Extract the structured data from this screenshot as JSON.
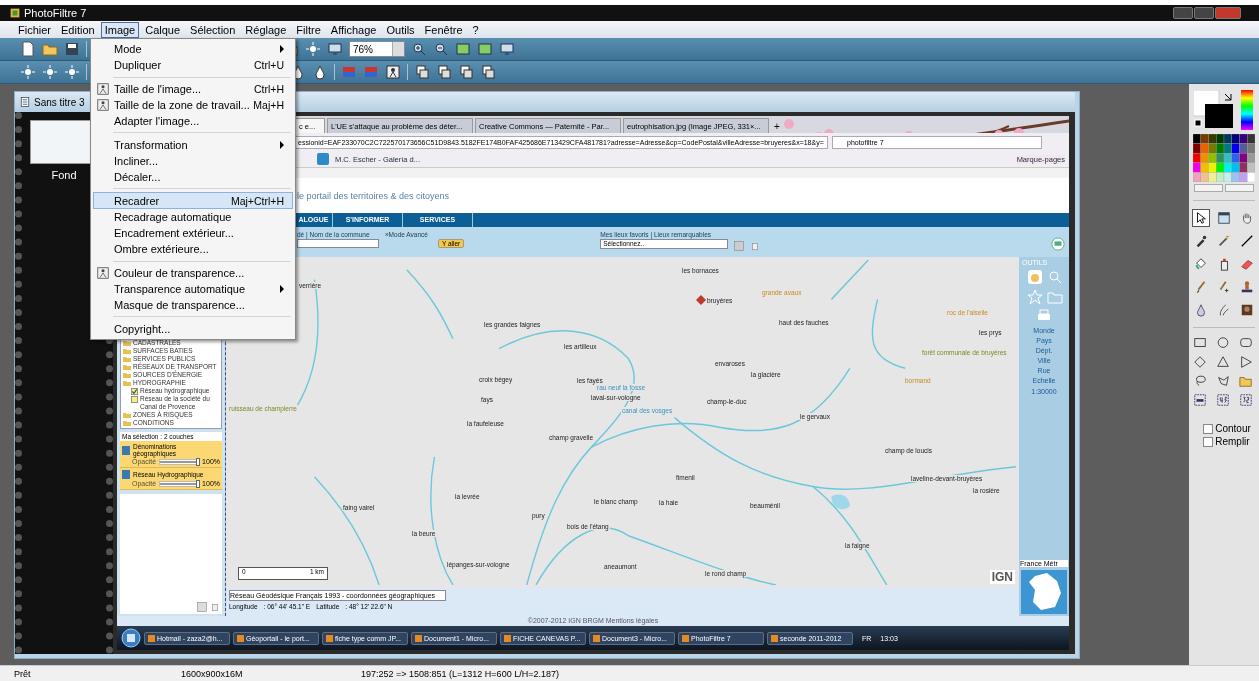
{
  "window": {
    "title": "PhotoFiltre 7"
  },
  "menu_bar": [
    {
      "label": "Fichier",
      "selected": false
    },
    {
      "label": "Edition",
      "selected": false
    },
    {
      "label": "Image",
      "selected": true
    },
    {
      "label": "Calque",
      "selected": false
    },
    {
      "label": "Sélection",
      "selected": false
    },
    {
      "label": "Réglage",
      "selected": false
    },
    {
      "label": "Filtre",
      "selected": false
    },
    {
      "label": "Affichage",
      "selected": false
    },
    {
      "label": "Outils",
      "selected": false
    },
    {
      "label": "Fenêtre",
      "selected": false
    },
    {
      "label": "?",
      "selected": false
    }
  ],
  "toolbar": {
    "zoom_value": "76%"
  },
  "image_menu": [
    {
      "kind": "item",
      "label": "Mode",
      "submenu": true,
      "selected": false
    },
    {
      "kind": "item",
      "label": "Dupliquer",
      "shortcut": "Ctrl+U",
      "selected": false
    },
    {
      "kind": "separator"
    },
    {
      "kind": "item",
      "label": "Taille de l'image...",
      "shortcut": "Ctrl+H",
      "icon": true,
      "selected": false
    },
    {
      "kind": "item",
      "label": "Taille de la zone de travail...",
      "shortcut": "Maj+H",
      "icon": true,
      "selected": false
    },
    {
      "kind": "item",
      "label": "Adapter l'image...",
      "selected": false
    },
    {
      "kind": "separator"
    },
    {
      "kind": "item",
      "label": "Transformation",
      "submenu": true,
      "selected": false
    },
    {
      "kind": "item",
      "label": "Incliner...",
      "selected": false
    },
    {
      "kind": "item",
      "label": "Décaler...",
      "selected": false
    },
    {
      "kind": "separator"
    },
    {
      "kind": "item",
      "label": "Recadrer",
      "shortcut": "Maj+Ctrl+H",
      "selected": true
    },
    {
      "kind": "item",
      "label": "Recadrage automatique",
      "selected": false
    },
    {
      "kind": "item",
      "label": "Encadrement extérieur...",
      "selected": false
    },
    {
      "kind": "item",
      "label": "Ombre extérieure...",
      "selected": false
    },
    {
      "kind": "separator"
    },
    {
      "kind": "item",
      "label": "Couleur de transparence...",
      "icon": true,
      "selected": false
    },
    {
      "kind": "item",
      "label": "Transparence automatique",
      "submenu": true,
      "selected": false
    },
    {
      "kind": "item",
      "label": "Masque de transparence...",
      "selected": false
    },
    {
      "kind": "separator"
    },
    {
      "kind": "item",
      "label": "Copyright...",
      "selected": false
    }
  ],
  "document": {
    "title": "Sans titre 3",
    "layers": [
      {
        "name": "Fond"
      }
    ]
  },
  "browser": {
    "tabs": [
      {
        "label": "c e...",
        "selected": true
      },
      {
        "label": "L'UE s'attaque au problème des déter...",
        "selected": false
      },
      {
        "label": "Creative Commons — Paternité - Par...",
        "selected": false
      },
      {
        "label": "eutrophisation.jpg (Image JPEG, 331×...",
        "selected": false
      }
    ],
    "new_tab": "+",
    "url": "essionid=EAF233070C2C722570173656C51D9843.5182FE174B0FAF425686E713429CFA481781?adresse=Adresse&cp=CodePostal&villeAdresse=bruyeres&x=18&y=",
    "search_value": "photofiltre 7",
    "bookmark": "M.C. Escher - Galería d...",
    "bookmarks_menu": "Marque-pages",
    "tagline": "le portail des territoires & des citoyens",
    "nav": [
      "ALOGUE",
      "S'INFORMER",
      "SERVICES"
    ],
    "search_label": "dé | Nom de la commune",
    "advanced_link": "»Mode Avancé",
    "go_button": "Y aller",
    "favorites_label": "Mes lieux favoris | Lieux remarquables",
    "favorites_select": "Sélectionnez..",
    "layer_tree": [
      {
        "label": "CADASTRALES"
      },
      {
        "label": "SURFACES BATIES"
      },
      {
        "label": "SERVICES PUBLICS"
      },
      {
        "label": "RÉSEAUX DE TRANSPORT"
      },
      {
        "label": "SOURCES D'ÉNERGIE"
      },
      {
        "label": "HYDROGRAPHIE",
        "children": [
          {
            "label": "Réseau hydrographique",
            "checked": true
          },
          {
            "label": "Réseau de la société du Canal de Provence",
            "checked": false
          }
        ]
      },
      {
        "label": "ZONES À RISQUES"
      },
      {
        "label": "CONDITIONS"
      }
    ],
    "selection_title": "Ma sélection : 2 couches",
    "selection_layers": [
      {
        "name": "Dénominations géographiques",
        "opacity_label": "Opacité",
        "level": 1,
        "reading": "100%"
      },
      {
        "name": "Réseau Hydrographique",
        "opacity_label": "Opacité",
        "level": 1,
        "reading": "100%"
      }
    ],
    "map_labels": [
      {
        "text": "les bornaces",
        "kind": "place"
      },
      {
        "text": "bruyères",
        "kind": "place"
      },
      {
        "text": "grande avaux",
        "kind": "area"
      },
      {
        "text": "haut des fauches",
        "kind": "place"
      },
      {
        "text": "les grandes faignes",
        "kind": "place"
      },
      {
        "text": "les artilleux",
        "kind": "place"
      },
      {
        "text": "croix bégey",
        "kind": "place"
      },
      {
        "text": "les fayés",
        "kind": "place"
      },
      {
        "text": "fays",
        "kind": "place"
      },
      {
        "text": "laval-sur-vologne",
        "kind": "place"
      },
      {
        "text": "envaroses",
        "kind": "place"
      },
      {
        "text": "la glacière",
        "kind": "place"
      },
      {
        "text": "champ-le-duc",
        "kind": "place"
      },
      {
        "text": "la faufeleuse",
        "kind": "place"
      },
      {
        "text": "champ gravelle",
        "kind": "place"
      },
      {
        "text": "le gervaux",
        "kind": "place"
      },
      {
        "text": "champ de loucis",
        "kind": "place"
      },
      {
        "text": "laveline-devant-bruyères",
        "kind": "place"
      },
      {
        "text": "la rosière",
        "kind": "place"
      },
      {
        "text": "fimenil",
        "kind": "place"
      },
      {
        "text": "le blanc champ",
        "kind": "place"
      },
      {
        "text": "la haie",
        "kind": "place"
      },
      {
        "text": "beauménil",
        "kind": "place"
      },
      {
        "text": "faing vairel",
        "kind": "place"
      },
      {
        "text": "la levrée",
        "kind": "place"
      },
      {
        "text": "pury",
        "kind": "place"
      },
      {
        "text": "bois de l'étang",
        "kind": "place"
      },
      {
        "text": "la beure",
        "kind": "place"
      },
      {
        "text": "lépanges-sur-vologne",
        "kind": "place"
      },
      {
        "text": "aneaumont",
        "kind": "place"
      },
      {
        "text": "le rond champ",
        "kind": "place"
      },
      {
        "text": "la faigne",
        "kind": "place"
      },
      {
        "text": "verrière",
        "kind": "place"
      },
      {
        "text": "roc de l'aiselle",
        "kind": "area"
      },
      {
        "text": "forêt communale de bruyères",
        "kind": "forest"
      },
      {
        "text": "bormand",
        "kind": "area"
      },
      {
        "text": "ruisseau de champlerre",
        "kind": "forest"
      },
      {
        "text": "rau neuf la fosse",
        "kind": "water"
      },
      {
        "text": "canal des vosges",
        "kind": "water"
      },
      {
        "text": "les prys",
        "kind": "place"
      }
    ],
    "scale": [
      "0",
      "1 km"
    ],
    "map_tools": {
      "title": "OUTILS",
      "levels": [
        "Monde",
        "Pays",
        "Dépt.",
        "Ville",
        "Rue"
      ],
      "scale_label": "Echelle",
      "scale_value": "1:30000",
      "region": "France Métr",
      "logo": "IGN"
    },
    "coord_system": "Réseau Géodésique Français 1993 - coordonnées géographiques",
    "longitude_label": "Longitude",
    "longitude": ": 06° 44' 45.1\" E",
    "latitude_label": "Latitude",
    "latitude": ": 48° 12' 22.6\" N",
    "copyright": "©2007-2012 IGN BRGM Mentions légales",
    "taskbar": [
      "Hotmail - zaza2@h...",
      "Géoportail - le port...",
      "fiche type comm JP...",
      "Document1 - Micro...",
      "FICHE CANEVAS P...",
      "Document3 - Micro...",
      "PhotoFiltre 7",
      "seconde 2011-2012"
    ],
    "tray": {
      "language": "FR",
      "time": "13:03"
    }
  },
  "tools": [
    {
      "selected": true
    },
    {
      "selected": false
    },
    {
      "selected": false
    },
    {
      "selected": false
    },
    {
      "selected": false
    },
    {
      "selected": false
    },
    {
      "selected": false
    },
    {
      "selected": false
    },
    {
      "selected": false
    },
    {
      "selected": false
    },
    {
      "selected": false
    },
    {
      "selected": false
    },
    {
      "selected": false
    },
    {
      "selected": false
    },
    {
      "selected": false
    }
  ],
  "options": [
    {
      "label": "Contour",
      "checked": false
    },
    {
      "label": "Remplir",
      "checked": false
    }
  ],
  "status_bar": [
    "Prêt",
    "1600x900x16M",
    "197:252 => 1508:851 (L=1312  H=600  L/H=2.187)"
  ]
}
